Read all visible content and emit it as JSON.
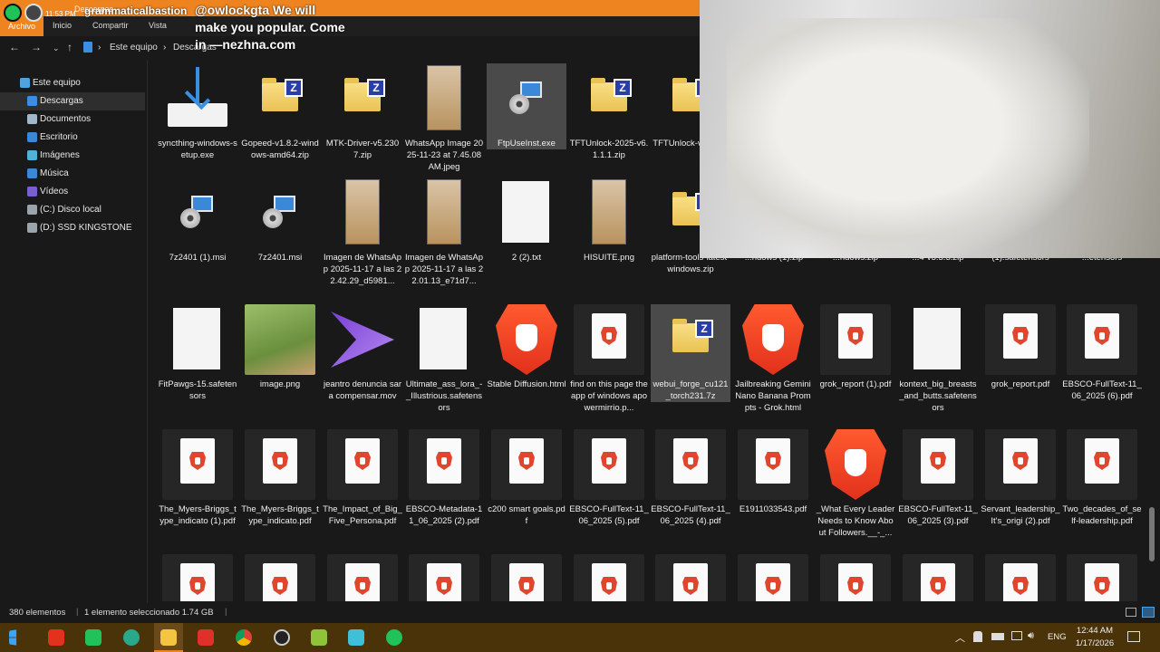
{
  "titlebar": {
    "username": "grammaticalbastion",
    "time_chip": "11:53 PM",
    "crumb_title": "Descargas"
  },
  "overlay_message": "@owlockgta We will make you popular. Come in —nezhna.com",
  "ribbon": {
    "file": "Archivo",
    "tabs": [
      "Inicio",
      "Compartir",
      "Vista"
    ]
  },
  "address": {
    "root": "Este equipo",
    "current": "Descargas"
  },
  "sidebar": {
    "items": [
      {
        "label": "Este equipo",
        "icon": "computer-icon",
        "color": "#4fa3e0"
      },
      {
        "label": "Descargas",
        "icon": "download-icon",
        "color": "#3b8ee0",
        "selected": true
      },
      {
        "label": "Documentos",
        "icon": "documents-icon",
        "color": "#9fb8cc"
      },
      {
        "label": "Escritorio",
        "icon": "desktop-icon",
        "color": "#3b88d8"
      },
      {
        "label": "Imágenes",
        "icon": "images-icon",
        "color": "#4fb3d8"
      },
      {
        "label": "Música",
        "icon": "music-icon",
        "color": "#3b88d8"
      },
      {
        "label": "Vídeos",
        "icon": "videos-icon",
        "color": "#7a5fd0"
      },
      {
        "label": "(C:) Disco local",
        "icon": "drive-icon",
        "color": "#9aa4ad"
      },
      {
        "label": "(D:) SSD KINGSTONE",
        "icon": "drive-icon",
        "color": "#9aa4ad"
      }
    ]
  },
  "files": [
    {
      "name": "syncthing-windows-setup.exe",
      "kind": "installer"
    },
    {
      "name": "Gopeed-v1.8.2-windows-amd64.zip",
      "kind": "zip"
    },
    {
      "name": "MTK-Driver-v5.2307.zip",
      "kind": "zip"
    },
    {
      "name": "WhatsApp Image 2025-11-23 at 7.45.08 AM.jpeg",
      "kind": "image"
    },
    {
      "name": "FtpUseInst.exe",
      "kind": "msi",
      "selected": true
    },
    {
      "name": "TFTUnlock-2025-v6.1.1.1.zip",
      "kind": "zip"
    },
    {
      "name": "TFTUnlock-v6.1.1.1",
      "kind": "zip"
    },
    {
      "name": "7z2401 (1).msi",
      "kind": "msi"
    },
    {
      "name": "7z2401.msi",
      "kind": "msi"
    },
    {
      "name": "Imagen de WhatsApp 2025-11-17 a las 22.42.29_d5981...",
      "kind": "image"
    },
    {
      "name": "Imagen de WhatsApp 2025-11-17 a las 22.01.13_e71d7...",
      "kind": "image"
    },
    {
      "name": "2 (2).txt",
      "kind": "txt"
    },
    {
      "name": "HISUITE.png",
      "kind": "image"
    },
    {
      "name": "platform-tools-latest-windows.zip",
      "kind": "zip"
    },
    {
      "name": "...ndows (1).zip",
      "kind": "partial"
    },
    {
      "name": "...ndows.zip",
      "kind": "partial"
    },
    {
      "name": "...4-v3.3.3.zip",
      "kind": "partial"
    },
    {
      "name": "(1).safetensors",
      "kind": "partial"
    },
    {
      "name": "...etensors",
      "kind": "partial"
    },
    {
      "name": "FitPawgs-15.safetensors",
      "kind": "txt"
    },
    {
      "name": "image.png",
      "kind": "photo"
    },
    {
      "name": "jeantro denuncia sara compensar.mov",
      "kind": "video"
    },
    {
      "name": "Ultimate_ass_lora_-_Illustrious.safetensors",
      "kind": "txt"
    },
    {
      "name": "Stable Diffusion.html",
      "kind": "brave"
    },
    {
      "name": "find on this page the app of windows apowermirrio.p...",
      "kind": "pdf"
    },
    {
      "name": "webui_forge_cu121_torch231.7z",
      "kind": "zip",
      "selected": true
    },
    {
      "name": "Jailbreaking Gemini Nano Banana Prompts - Grok.html",
      "kind": "brave"
    },
    {
      "name": "grok_report (1).pdf",
      "kind": "pdf"
    },
    {
      "name": "kontext_big_breasts_and_butts.safetensors",
      "kind": "txt"
    },
    {
      "name": "grok_report.pdf",
      "kind": "pdf"
    },
    {
      "name": "EBSCO-FullText-11_06_2025 (6).pdf",
      "kind": "pdf"
    },
    {
      "name": "The_Myers-Briggs_type_indicato (1).pdf",
      "kind": "pdf"
    },
    {
      "name": "The_Myers-Briggs_type_indicato.pdf",
      "kind": "pdf"
    },
    {
      "name": "The_Impact_of_Big_Five_Persona.pdf",
      "kind": "pdf"
    },
    {
      "name": "EBSCO-Metadata-11_06_2025 (2).pdf",
      "kind": "pdf"
    },
    {
      "name": "c200 smart goals.pdf",
      "kind": "pdf"
    },
    {
      "name": "EBSCO-FullText-11_06_2025 (5).pdf",
      "kind": "pdf"
    },
    {
      "name": "EBSCO-FullText-11_06_2025 (4).pdf",
      "kind": "pdf"
    },
    {
      "name": "E1911033543.pdf",
      "kind": "pdf"
    },
    {
      "name": "_What Every Leader Needs to Know About Followers.__-_...",
      "kind": "brave"
    },
    {
      "name": "EBSCO-FullText-11_06_2025 (3).pdf",
      "kind": "pdf"
    },
    {
      "name": "Servant_leadership_It's_origi (2).pdf",
      "kind": "pdf"
    },
    {
      "name": "Two_decades_of_self-leadership.pdf",
      "kind": "pdf"
    }
  ],
  "status": {
    "count": "380 elementos",
    "selection": "1 elemento seleccionado  1.74 GB"
  },
  "taskbar": {
    "time": "12:44 AM",
    "date": "1/17/2026",
    "lang": "ENG"
  },
  "colors": {
    "accent": "#ee8420",
    "folder": "#f4d46c",
    "pdf": "#e0452e"
  }
}
